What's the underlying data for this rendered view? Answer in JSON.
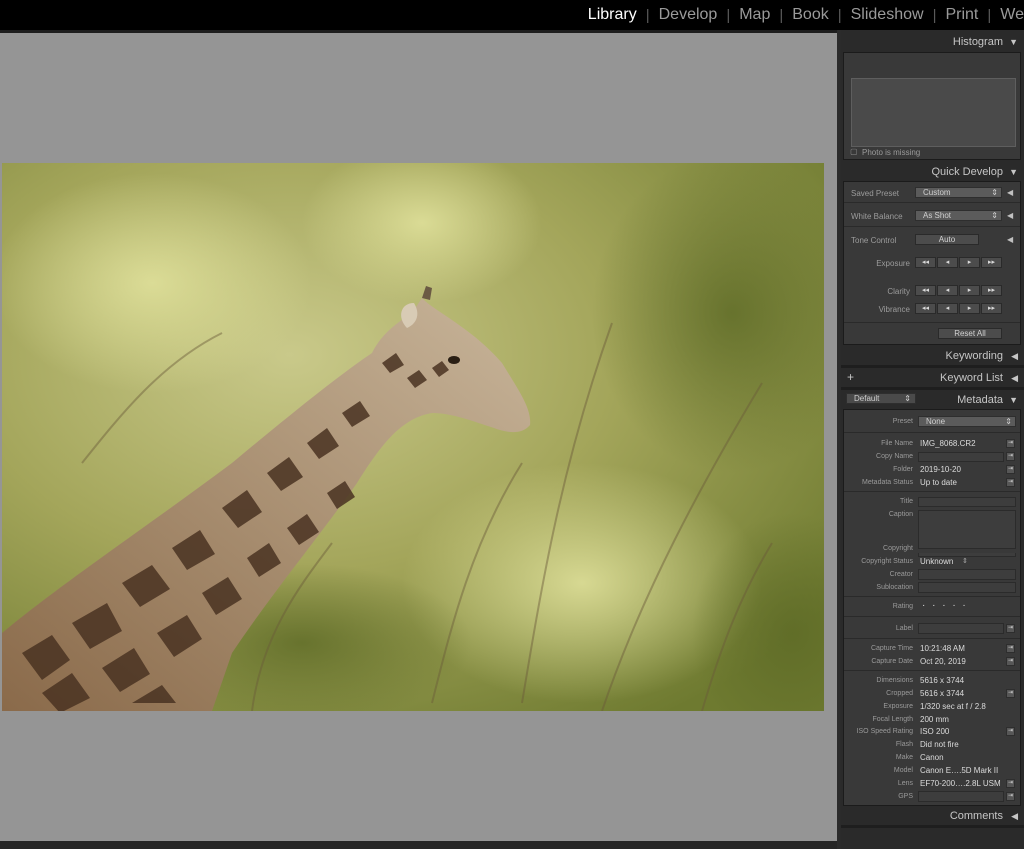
{
  "modules": {
    "items": [
      "Library",
      "Develop",
      "Map",
      "Book",
      "Slideshow",
      "Print",
      "We"
    ],
    "active": "Library"
  },
  "colors": {
    "background": "#959595",
    "panel": "#393939",
    "active_text": "#ffffff"
  },
  "histogram": {
    "title": "Histogram",
    "status": "Photo is missing",
    "status_icon": "missing-photo-icon"
  },
  "quick_develop": {
    "title": "Quick Develop",
    "saved_preset_label": "Saved Preset",
    "saved_preset_value": "Custom",
    "white_balance_label": "White Balance",
    "white_balance_value": "As Shot",
    "tone_control_label": "Tone Control",
    "auto_label": "Auto",
    "exposure_label": "Exposure",
    "clarity_label": "Clarity",
    "vibrance_label": "Vibrance",
    "step_buttons": [
      "◂◂",
      "◂",
      "▸",
      "▸▸"
    ],
    "reset_label": "Reset All"
  },
  "keywording": {
    "title": "Keywording"
  },
  "keyword_list": {
    "title": "Keyword List",
    "add_symbol": "+"
  },
  "metadata": {
    "title": "Metadata",
    "view_select": "Default",
    "preset_label": "Preset",
    "preset_value": "None",
    "file_name_label": "File Name",
    "file_name": "IMG_8068.CR2",
    "copy_name_label": "Copy Name",
    "folder_label": "Folder",
    "folder": "2019-10-20",
    "metadata_status_label": "Metadata Status",
    "metadata_status": "Up to date",
    "title_label": "Title",
    "caption_label": "Caption",
    "copyright_label": "Copyright",
    "copyright_status_label": "Copyright Status",
    "copyright_status": "Unknown",
    "creator_label": "Creator",
    "sublocation_label": "Sublocation",
    "rating_label": "Rating",
    "rating": "· · · · ·",
    "label_label": "Label",
    "capture_time_label": "Capture Time",
    "capture_time": "10:21:48 AM",
    "capture_date_label": "Capture Date",
    "capture_date": "Oct 20, 2019",
    "dimensions_label": "Dimensions",
    "dimensions": "5616 x 3744",
    "cropped_label": "Cropped",
    "cropped": "5616 x 3744",
    "exposure_label": "Exposure",
    "exposure": "1/320 sec at f / 2.8",
    "focal_length_label": "Focal Length",
    "focal_length": "200 mm",
    "iso_label": "ISO Speed Rating",
    "iso": "ISO 200",
    "flash_label": "Flash",
    "flash": "Did not fire",
    "make_label": "Make",
    "make": "Canon",
    "model_label": "Model",
    "model": "Canon E….5D Mark II",
    "lens_label": "Lens",
    "lens": "EF70-200….2.8L USM",
    "gps_label": "GPS"
  },
  "comments": {
    "title": "Comments"
  },
  "photo": {
    "subject": "giraffe-photo"
  }
}
